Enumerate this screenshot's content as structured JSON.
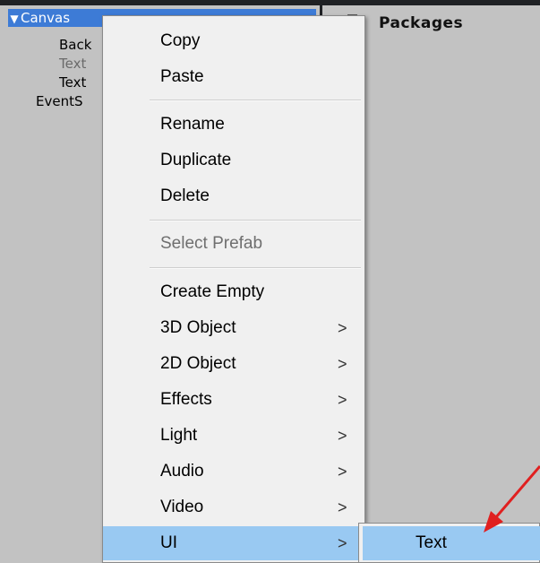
{
  "hierarchy": {
    "items": [
      {
        "label": "Canvas"
      },
      {
        "label": "Back"
      },
      {
        "label": "Text"
      },
      {
        "label": "Text"
      },
      {
        "label": "EventS"
      }
    ]
  },
  "project": {
    "folder": "Packages"
  },
  "menu": {
    "copy": "Copy",
    "paste": "Paste",
    "rename": "Rename",
    "duplicate": "Duplicate",
    "delete": "Delete",
    "select_prefab": "Select Prefab",
    "create_empty": "Create Empty",
    "obj3d": "3D Object",
    "obj2d": "2D Object",
    "effects": "Effects",
    "light": "Light",
    "audio": "Audio",
    "video": "Video",
    "ui": "UI",
    "arrow": ">"
  },
  "submenu": {
    "text": "Text"
  },
  "colors": {
    "highlight": "#99c9f2",
    "selection": "#3d7bd6",
    "annotation": "#e02020"
  }
}
